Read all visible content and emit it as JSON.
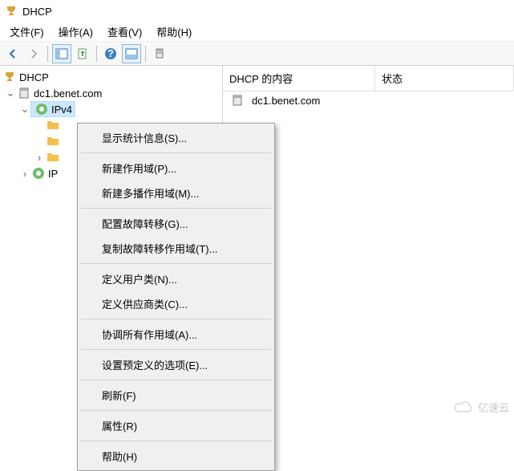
{
  "window": {
    "title": "DHCP"
  },
  "menubar": {
    "file": "文件(F)",
    "action": "操作(A)",
    "view": "查看(V)",
    "help": "帮助(H)"
  },
  "tree": {
    "root": "DHCP",
    "server": "dc1.benet.com",
    "ipv4": "IPv4",
    "ipv6_prefix": "IP"
  },
  "list": {
    "col_name": "DHCP 的内容",
    "col_status": "状态",
    "row1": "dc1.benet.com"
  },
  "contextMenu": {
    "items": [
      "显示统计信息(S)...",
      "新建作用域(P)...",
      "新建多播作用域(M)...",
      "配置故障转移(G)...",
      "复制故障转移作用域(T)...",
      "定义用户类(N)...",
      "定义供应商类(C)...",
      "协调所有作用域(A)...",
      "设置预定义的选项(E)...",
      "刷新(F)",
      "属性(R)",
      "帮助(H)"
    ]
  },
  "watermark": {
    "text": "亿速云"
  }
}
